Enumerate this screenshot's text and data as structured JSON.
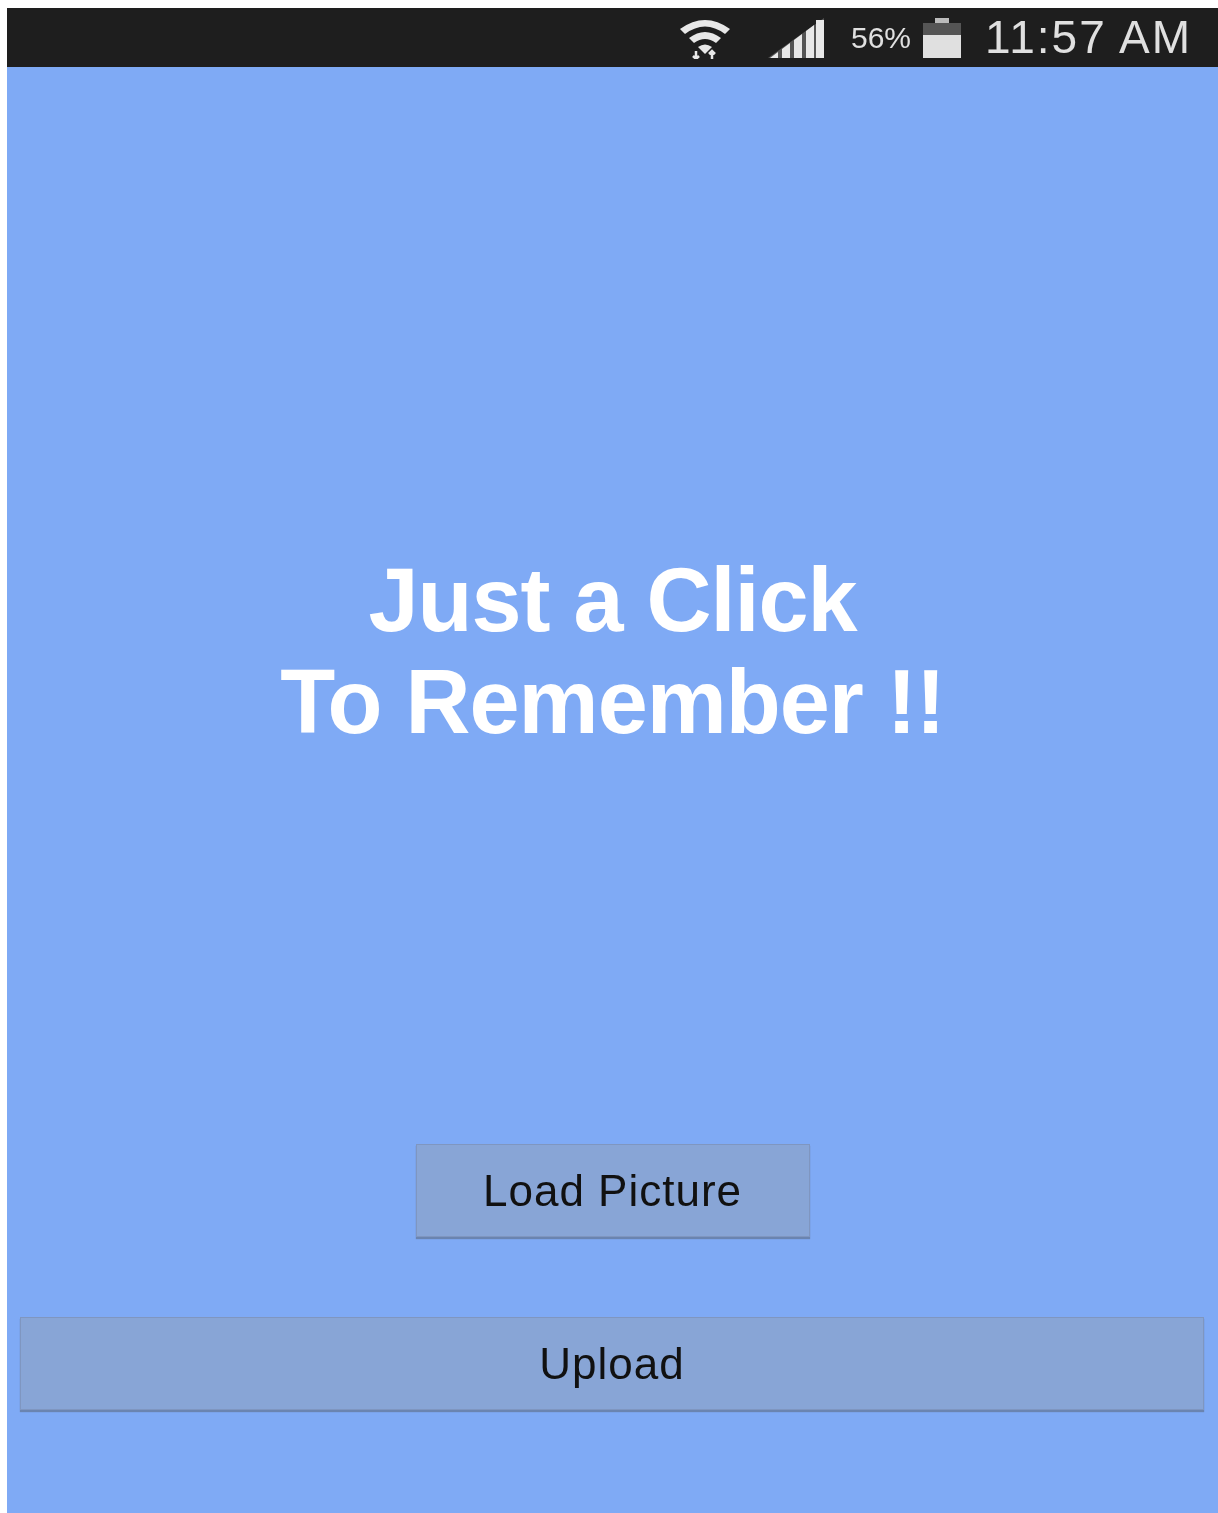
{
  "status_bar": {
    "battery": "56%",
    "time": "11:57 AM"
  },
  "headline": [
    "Just a Click",
    "To Remember !!"
  ],
  "buttons": [
    {
      "label": "Load Picture",
      "kind": "compact"
    },
    {
      "label": "Upload",
      "kind": "full"
    }
  ]
}
